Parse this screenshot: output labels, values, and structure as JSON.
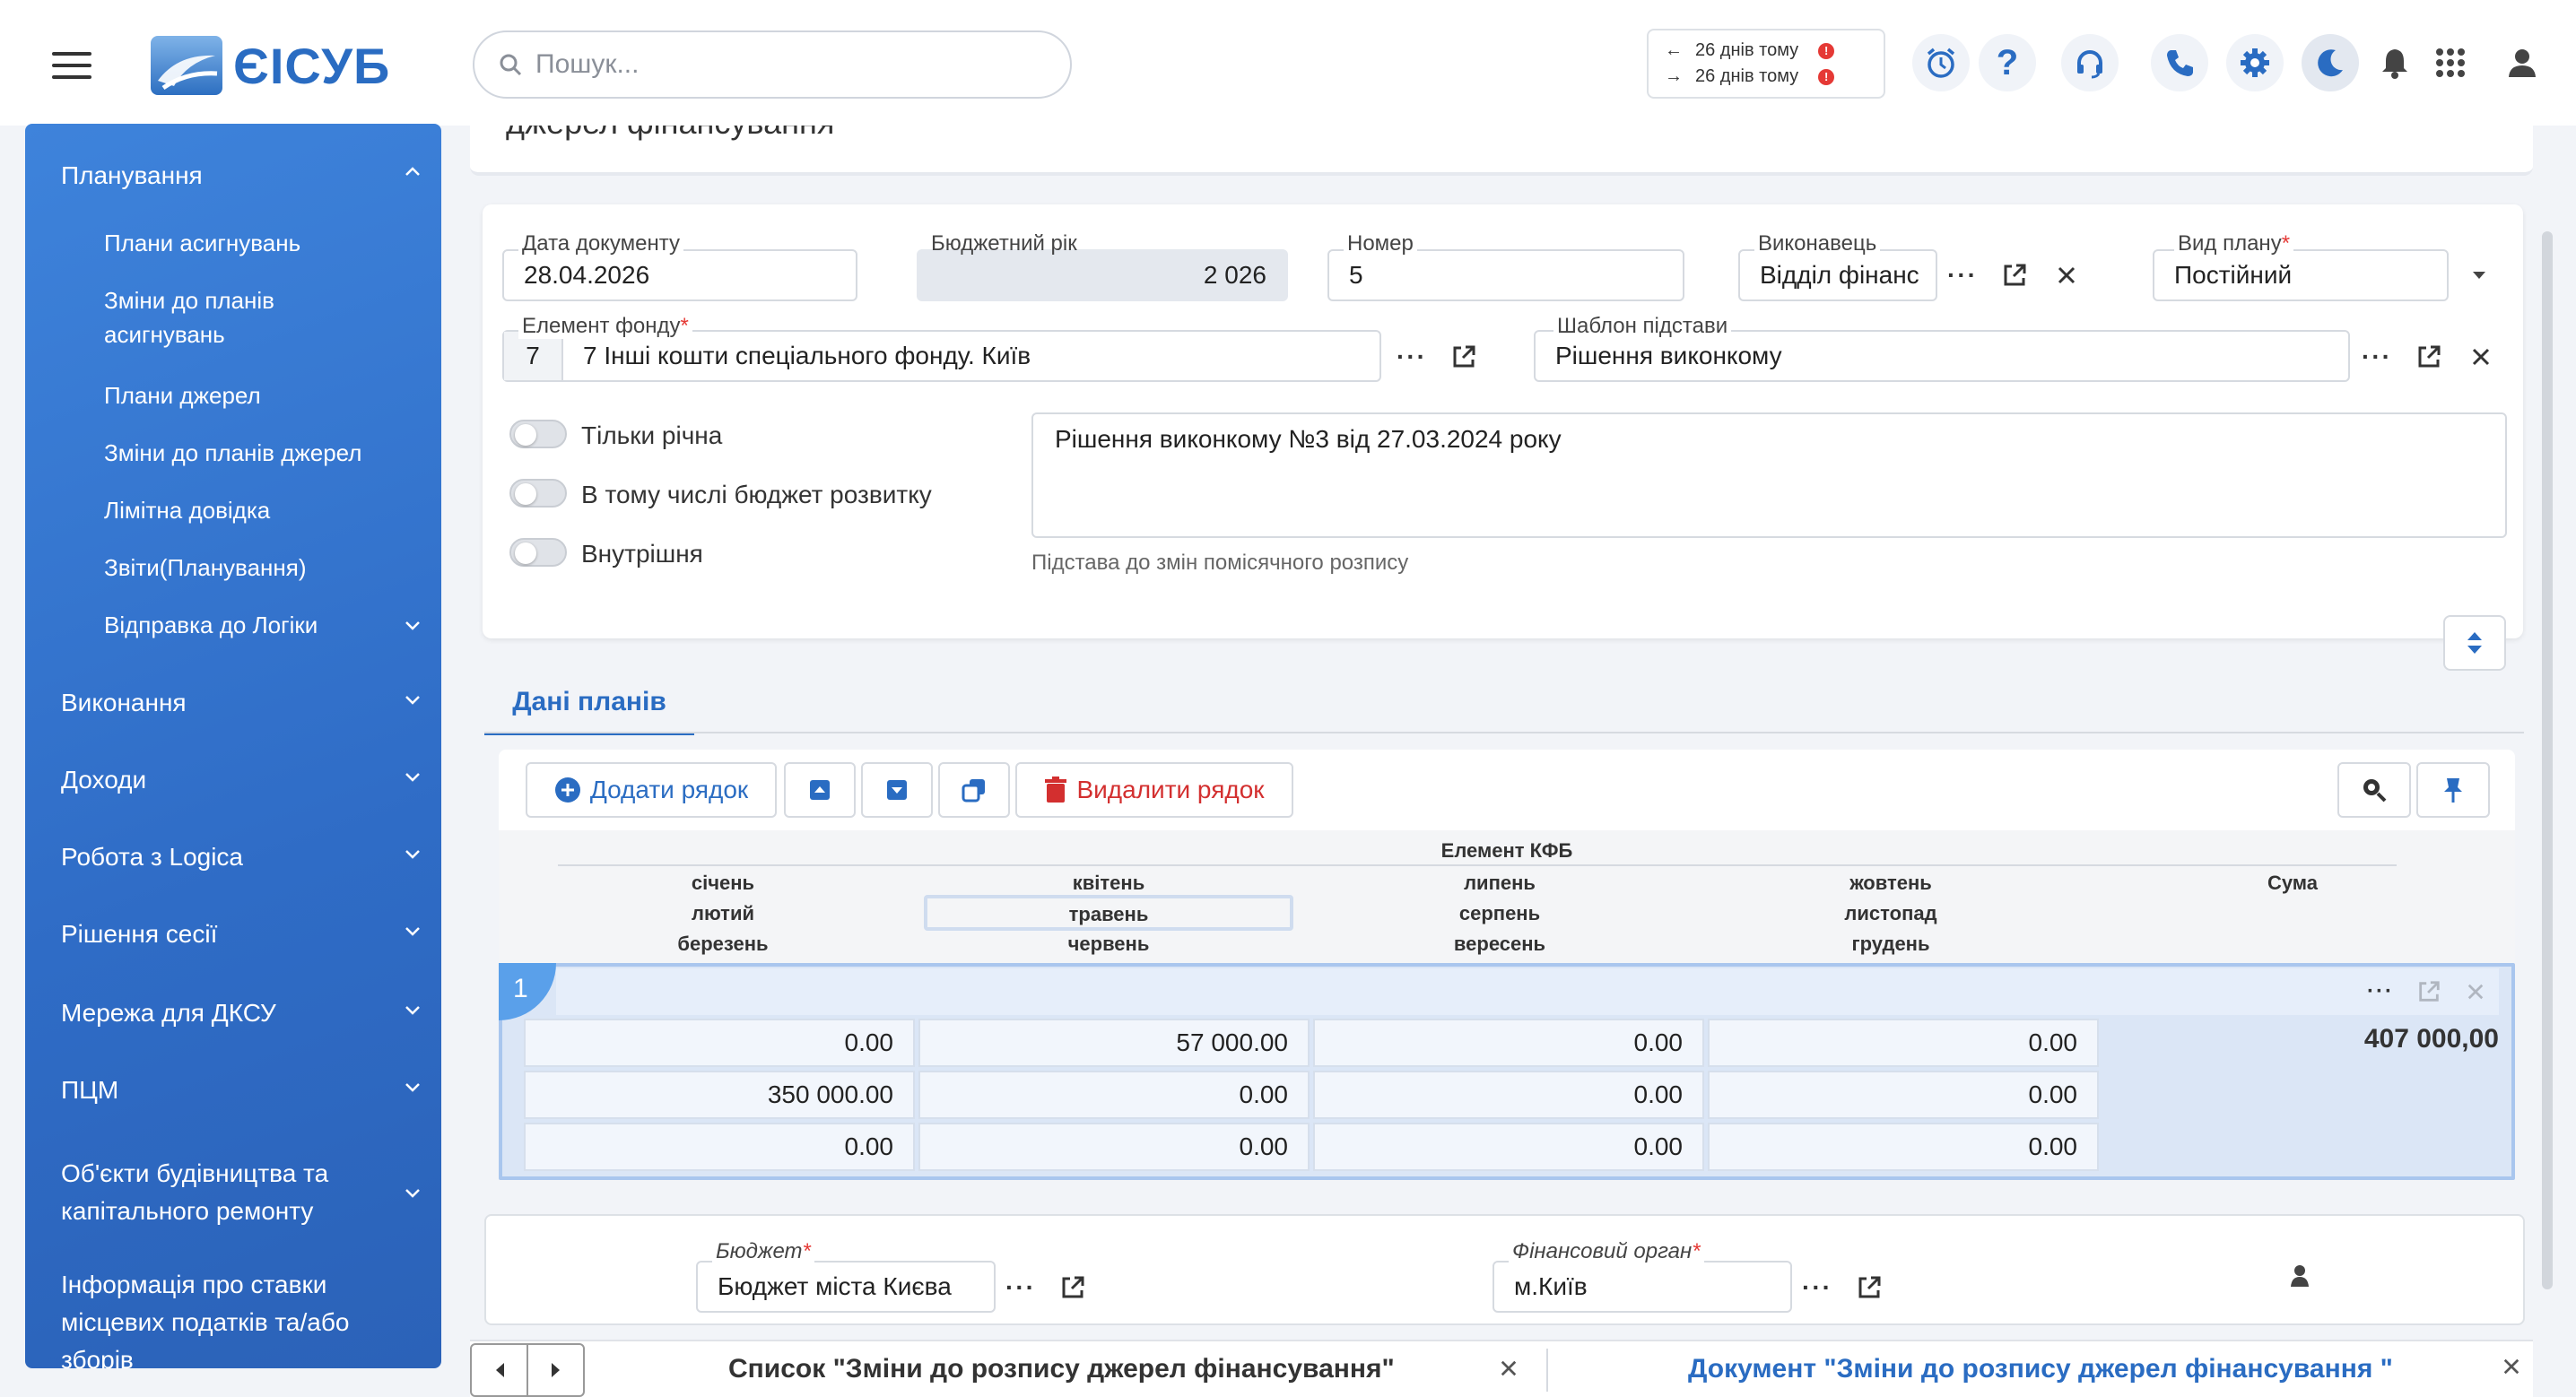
{
  "header": {
    "logo_text": "ЄІСУБ",
    "search_placeholder": "Пошук...",
    "history": [
      {
        "label": "26 днів тому",
        "direction": "back"
      },
      {
        "label": "26 днів тому",
        "direction": "forward"
      }
    ],
    "icons": [
      "alarm-clock-icon",
      "help-icon",
      "headset-icon",
      "phone-icon",
      "gear-icon",
      "moon-icon",
      "bell-icon",
      "apps-grid-icon",
      "user-icon"
    ]
  },
  "sidebar": {
    "sections": [
      {
        "label": "Планування",
        "expanded": true,
        "items": [
          "Плани асигнувань",
          "Зміни до планів асигнувань",
          "Плани джерел",
          "Зміни до планів джерел",
          "Лімітна довідка",
          "Звіти(Планування)",
          "Відправка до Логіки"
        ]
      },
      {
        "label": "Виконання"
      },
      {
        "label": "Доходи"
      },
      {
        "label": "Робота з Logica"
      },
      {
        "label": "Рішення сесії"
      },
      {
        "label": "Мережа для ДКСУ"
      },
      {
        "label": "ПЦМ"
      },
      {
        "label": "Об'єкти будівництва та капітального ремонту"
      },
      {
        "label": "Інформація про ставки місцевих податків та/або зборів"
      }
    ]
  },
  "page": {
    "title": "джерел фінансування"
  },
  "form": {
    "doc_date": {
      "label": "Дата документу",
      "value": "28.04.2026"
    },
    "budget_year": {
      "label": "Бюджетний рік",
      "value": "2 026"
    },
    "number": {
      "label": "Номер",
      "value": "5"
    },
    "executor": {
      "label": "Виконавець",
      "value": "Відділ фінанс"
    },
    "plan_type": {
      "label": "Вид плану",
      "value": "Постійний",
      "required": true
    },
    "fund_element": {
      "label": "Елемент фонду",
      "code": "7",
      "value": "7 Інші кошти спеціального фонду. Київ",
      "required": true
    },
    "basis_template": {
      "label": "Шаблон підстави",
      "value": "Рішення виконкому"
    },
    "toggles": [
      {
        "label": "Тільки річна",
        "on": false
      },
      {
        "label": "В тому числі бюджет розвитку",
        "on": false
      },
      {
        "label": "Внутрішня",
        "on": false
      }
    ],
    "basis_text": "Рішення виконкому №3 від 27.03.2024 року",
    "basis_hint": "Підстава до змін помісячного розпису"
  },
  "tabs": [
    {
      "label": "Дані планів",
      "active": true
    }
  ],
  "grid": {
    "toolbar": {
      "add_row": "Додати рядок",
      "delete_row": "Видалити рядок"
    },
    "header": {
      "kfb": "Елемент КФБ",
      "months": [
        [
          "січень",
          "квітень",
          "липень",
          "жовтень"
        ],
        [
          "лютий",
          "травень",
          "серпень",
          "листопад"
        ],
        [
          "березень",
          "червень",
          "вересень",
          "грудень"
        ]
      ],
      "sum": "Сума"
    },
    "row": {
      "number": "1",
      "values": [
        [
          "0.00",
          "57 000.00",
          "0.00",
          "0.00"
        ],
        [
          "350 000.00",
          "0.00",
          "0.00",
          "0.00"
        ],
        [
          "0.00",
          "0.00",
          "0.00",
          "0.00"
        ]
      ],
      "total": "407 000,00"
    }
  },
  "footer": {
    "budget": {
      "label": "Бюджет",
      "value": "Бюджет міста Києва",
      "required": true
    },
    "fin_org": {
      "label": "Фінансовий орган",
      "value": "м.Київ",
      "required": true
    }
  },
  "bottom_tabs": [
    {
      "label": "Список \"Зміни до розпису джерел фінансування\"",
      "active": false
    },
    {
      "label": "Документ \"Зміни до розпису джерел фінансування \"",
      "active": true
    }
  ],
  "colors": {
    "accent": "#2a6cc2",
    "sidebar": "#3377d0",
    "danger": "#e53935",
    "row_highlight": "#dbe6f6"
  }
}
